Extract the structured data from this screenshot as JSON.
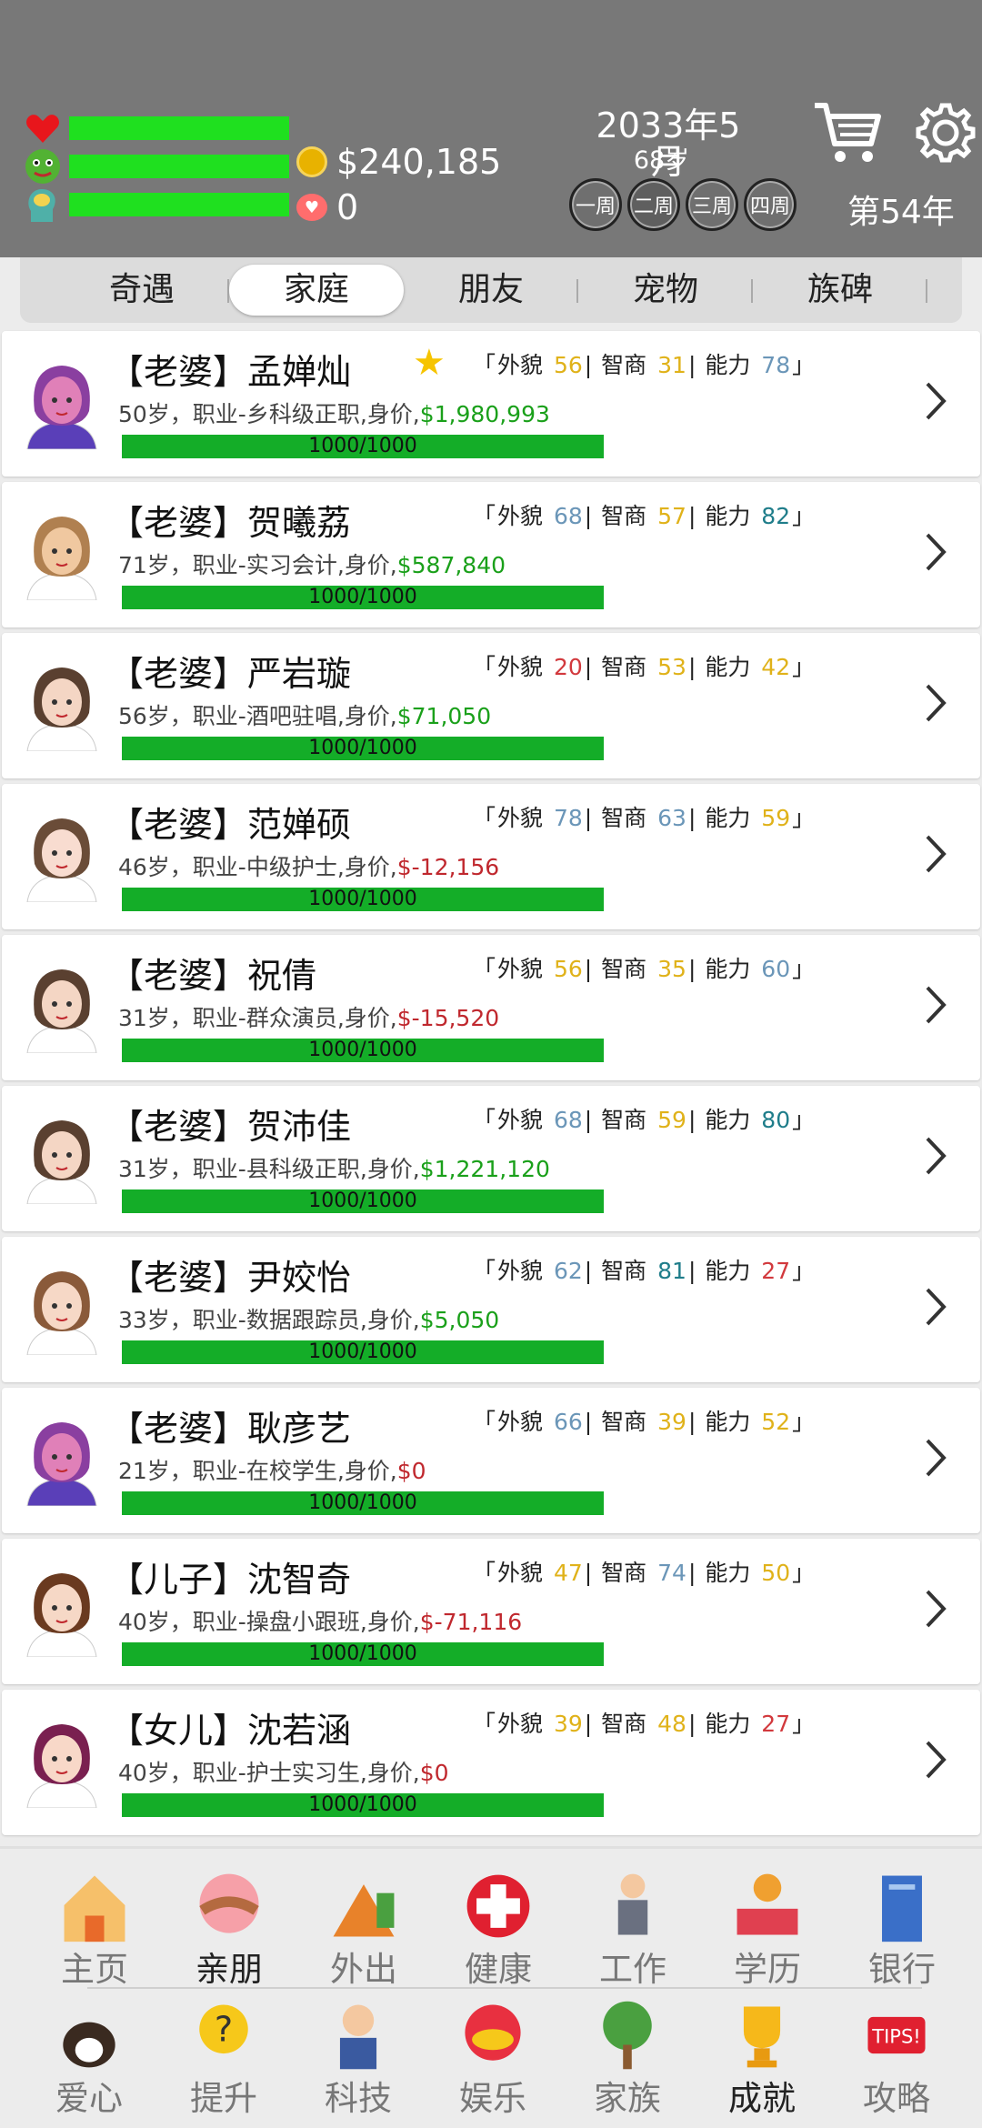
{
  "header": {
    "money": "$240,185",
    "hearts": "0",
    "date": "2033年5月",
    "age": "68岁",
    "weeks": [
      "一周",
      "二周",
      "三周",
      "四周"
    ],
    "turn": "第54年"
  },
  "tabs": [
    "奇遇",
    "家庭",
    "朋友",
    "宠物",
    "族碑"
  ],
  "members": [
    {
      "name": "【老婆】孟婵灿",
      "looks": "56",
      "iq": "31",
      "ability": "78",
      "age_job": "50岁，职业-乡科级正职,身价,",
      "value": "$1,980,993",
      "progress": "1000/1000"
    },
    {
      "name": "【老婆】贺曦荔",
      "looks": "68",
      "iq": "57",
      "ability": "82",
      "age_job": "71岁，职业-实习会计,身价,",
      "value": "$587,840",
      "progress": "1000/1000"
    },
    {
      "name": "【老婆】严岩璇",
      "looks": "20",
      "iq": "53",
      "ability": "42",
      "age_job": "56岁，职业-酒吧驻唱,身价,",
      "value": "$71,050",
      "progress": "1000/1000"
    },
    {
      "name": "【老婆】范婵硕",
      "looks": "78",
      "iq": "63",
      "ability": "59",
      "age_job": "46岁，职业-中级护士,身价,",
      "value": "$-12,156",
      "progress": "1000/1000"
    },
    {
      "name": "【老婆】祝倩",
      "looks": "56",
      "iq": "35",
      "ability": "60",
      "age_job": "31岁，职业-群众演员,身价,",
      "value": "$-15,520",
      "progress": "1000/1000"
    },
    {
      "name": "【老婆】贺沛佳",
      "looks": "68",
      "iq": "59",
      "ability": "80",
      "age_job": "31岁，职业-县科级正职,身价,",
      "value": "$1,221,120",
      "progress": "1000/1000"
    },
    {
      "name": "【老婆】尹姣怡",
      "looks": "62",
      "iq": "81",
      "ability": "27",
      "age_job": "33岁，职业-数据跟踪员,身价,",
      "value": "$5,050",
      "progress": "1000/1000"
    },
    {
      "name": "【老婆】耿彦艺",
      "looks": "66",
      "iq": "39",
      "ability": "52",
      "age_job": "21岁，职业-在校学生,身价,",
      "value": "$0",
      "progress": "1000/1000"
    },
    {
      "name": "【儿子】沈智奇",
      "looks": "47",
      "iq": "74",
      "ability": "50",
      "age_job": "40岁，职业-操盘小跟班,身价,",
      "value": "$-71,116",
      "progress": "1000/1000"
    },
    {
      "name": "【女儿】沈若涵",
      "looks": "39",
      "iq": "48",
      "ability": "27",
      "age_job": "40岁，职业-护士实习生,身价,",
      "value": "$0",
      "progress": "1000/1000"
    }
  ],
  "labels": {
    "looks": "外貌",
    "iq": "智商",
    "ability": "能力"
  },
  "nav_row1": [
    "主页",
    "亲朋",
    "外出",
    "健康",
    "工作",
    "学历",
    "银行"
  ],
  "nav_row2": [
    "爱心",
    "提升",
    "科技",
    "娱乐",
    "家族",
    "成就",
    "攻略"
  ]
}
